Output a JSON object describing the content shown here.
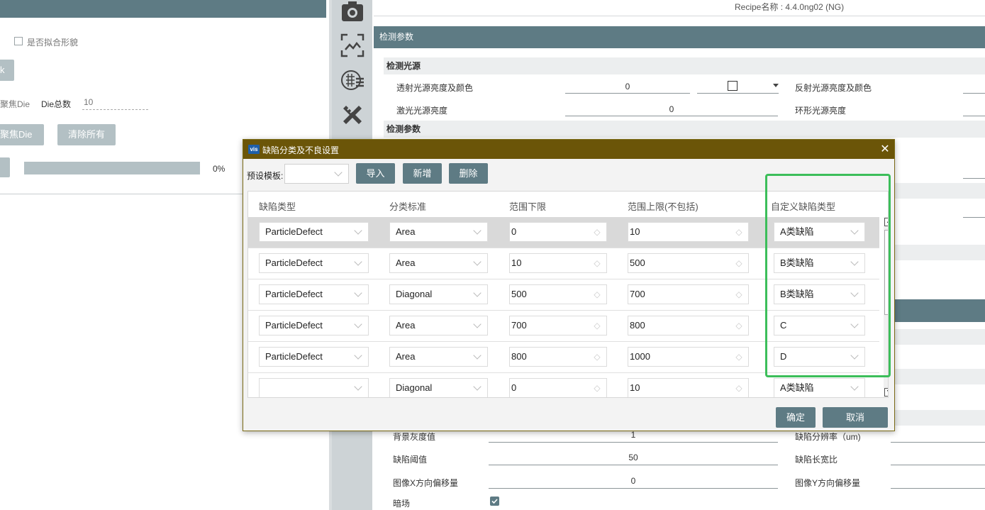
{
  "left_panel": {
    "checkbox_label": "是否拟合形貌",
    "btn_k": "k",
    "focus_die_label": "聚焦Die",
    "die_total_label": "Die总数",
    "die_total_value": "10",
    "focus_die_button": "聚焦Die",
    "clear_all_button": "清除所有",
    "progress_text": "0%",
    "progress_value": 0
  },
  "right_panel": {
    "recipe": "Recipe名称 : 4.4.0ng02 (NG)",
    "header": "检测参数",
    "section_light": "检测光源",
    "transmit_label": "透射光源亮度及颜色",
    "transmit_value": "0",
    "reflect_label": "反射光源亮度及颜色",
    "laser_label": "激光光源亮度",
    "laser_value": "0",
    "ring_label": "环形光源亮度",
    "section_params": "检测参数",
    "bg_gray_label": "背景灰度值",
    "bg_gray_value": "1",
    "defect_res_label": "缺陷分辨率（um)",
    "defect_th_label": "缺陷阈值",
    "defect_th_value": "50",
    "defect_ratio_label": "缺陷长宽比",
    "img_x_label": "图像X方向偏移量",
    "img_x_value": "0",
    "img_y_label": "图像Y方向偏移量",
    "dark_label": "暗场"
  },
  "dialog": {
    "title": "缺陷分类及不良设置",
    "preset_label": "预设模板:",
    "import_btn": "导入",
    "add_btn": "新增",
    "delete_btn": "删除",
    "ok_btn": "确定",
    "cancel_btn": "取消",
    "columns": [
      "缺陷类型",
      "分类标准",
      "范围下限",
      "范围上限(不包括)",
      "自定义缺陷类型"
    ],
    "rows": [
      {
        "type": "ParticleDefect",
        "criteria": "Area",
        "low": "0",
        "high": "10",
        "custom": "A类缺陷"
      },
      {
        "type": "ParticleDefect",
        "criteria": "Area",
        "low": "10",
        "high": "500",
        "custom": "B类缺陷"
      },
      {
        "type": "ParticleDefect",
        "criteria": "Diagonal",
        "low": "500",
        "high": "700",
        "custom": "B类缺陷"
      },
      {
        "type": "ParticleDefect",
        "criteria": "Area",
        "low": "700",
        "high": "800",
        "custom": "C"
      },
      {
        "type": "ParticleDefect",
        "criteria": "Area",
        "low": "800",
        "high": "1000",
        "custom": "D"
      },
      {
        "type": "",
        "criteria": "Diagonal",
        "low": "0",
        "high": "10",
        "custom": "A类缺陷"
      }
    ]
  }
}
